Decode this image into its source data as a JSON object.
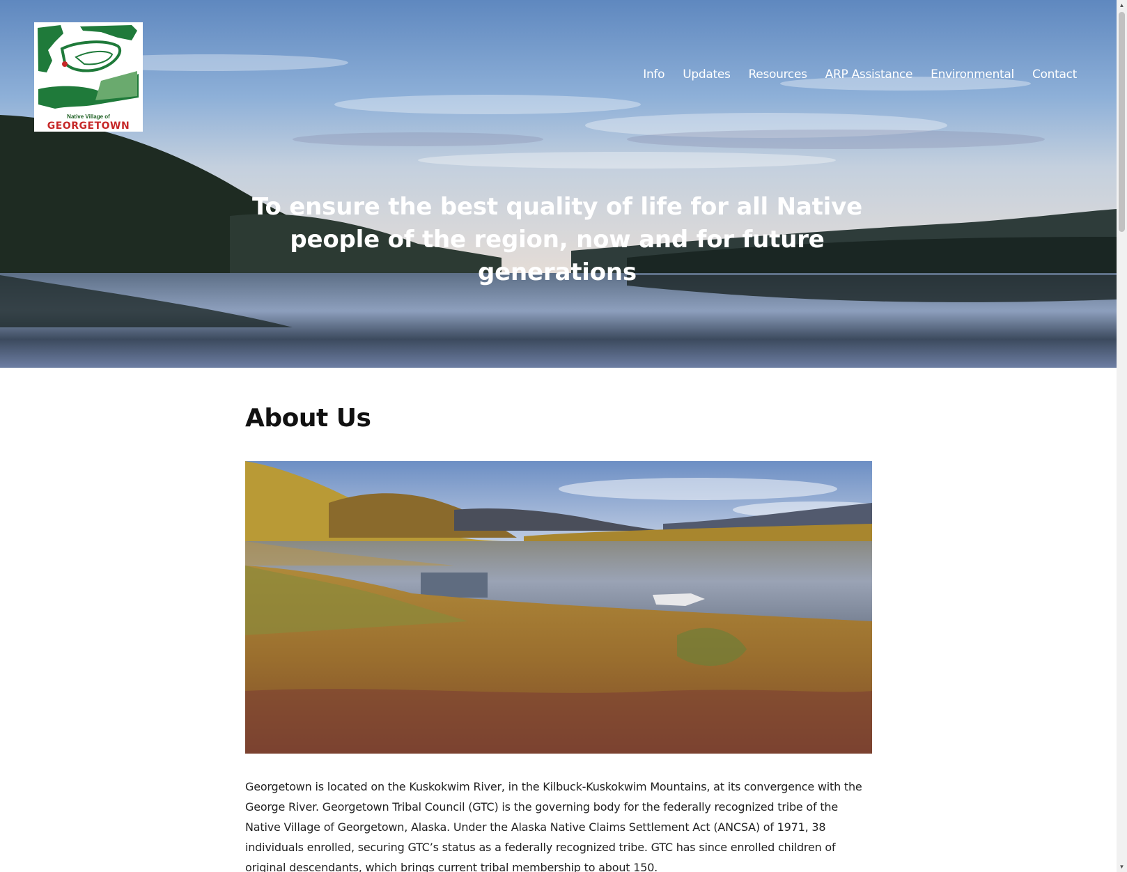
{
  "logo": {
    "line1": "Native Village of",
    "line2": "GEORGETOWN"
  },
  "nav": {
    "items": [
      {
        "label": "Info"
      },
      {
        "label": "Updates"
      },
      {
        "label": "Resources"
      },
      {
        "label": "ARP Assistance"
      },
      {
        "label": "Environmental"
      },
      {
        "label": "Contact"
      }
    ]
  },
  "hero": {
    "tagline": "To ensure the best quality of life for all Native people of the region, now and for future generations"
  },
  "about": {
    "title": "About Us",
    "paragraph": "Georgetown is located on the Kuskokwim River, in the Kilbuck-Kuskokwim Mountains, at its convergence with the George River. Georgetown Tribal Council (GTC) is the governing body for the federally recognized tribe of the Native Village of Georgetown, Alaska. Under the Alaska Native Claims Settlement Act (ANCSA) of 1971, 38 individuals enrolled, securing GTC’s status as a federally recognized tribe. GTC has since enrolled children of original descendants, which brings current tribal membership to about 150."
  },
  "scrollbar": {
    "up_icon": "▲",
    "down_icon": "▼"
  }
}
